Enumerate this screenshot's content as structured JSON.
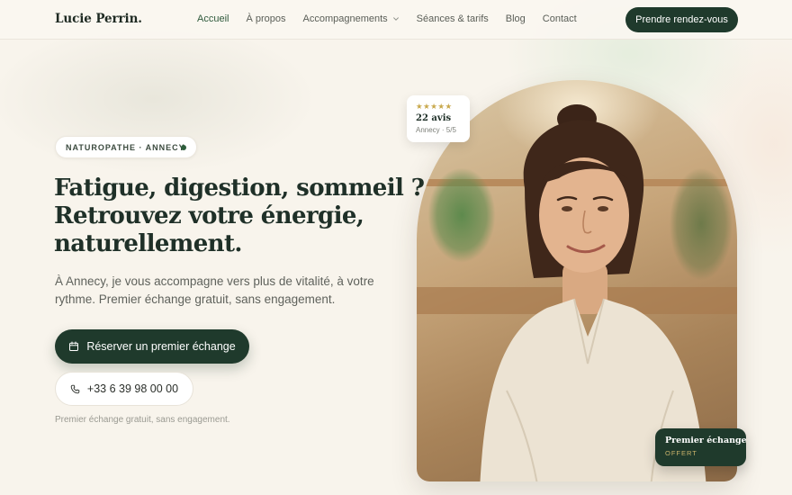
{
  "brand": {
    "name": "Lucie Perrin."
  },
  "nav": {
    "items": [
      {
        "label": "Accueil",
        "active": true
      },
      {
        "label": "À propos",
        "active": false
      },
      {
        "label": "Accompagnements",
        "active": false,
        "has_dropdown": true
      },
      {
        "label": "Séances & tarifs",
        "active": false
      },
      {
        "label": "Blog",
        "active": false
      },
      {
        "label": "Contact",
        "active": false
      }
    ],
    "cta_label": "Prendre rendez-vous"
  },
  "hero": {
    "badge": "NATUROPATHE · ANNECY",
    "headline": [
      "Fatigue, digestion, sommeil ?",
      "Retrouvez votre énergie,",
      "naturellement."
    ],
    "lead": [
      "À Annecy, je vous accompagne vers plus de vitalité, à votre",
      "rythme. Premier échange gratuit, sans engagement."
    ],
    "primary_button": {
      "label": "Réserver un premier échange",
      "icon": "calendar-icon"
    },
    "secondary_button": {
      "label": "+33 6 39 98 00 00",
      "icon": "phone-icon"
    },
    "note": "Premier échange gratuit, sans engagement."
  },
  "rating_card": {
    "stars": "★★★★★",
    "rating": 5,
    "count": "22 avis",
    "meta": "Annecy · 5/5"
  },
  "offer_card": {
    "title": "Premier échange",
    "subtitle": "OFFERT"
  },
  "colors": {
    "background": "#f8f4ec",
    "primary": "#1f3a2c",
    "active_nav": "#2f5a3c",
    "star": "#c8a84b",
    "offer_accent": "#c9b26a"
  }
}
